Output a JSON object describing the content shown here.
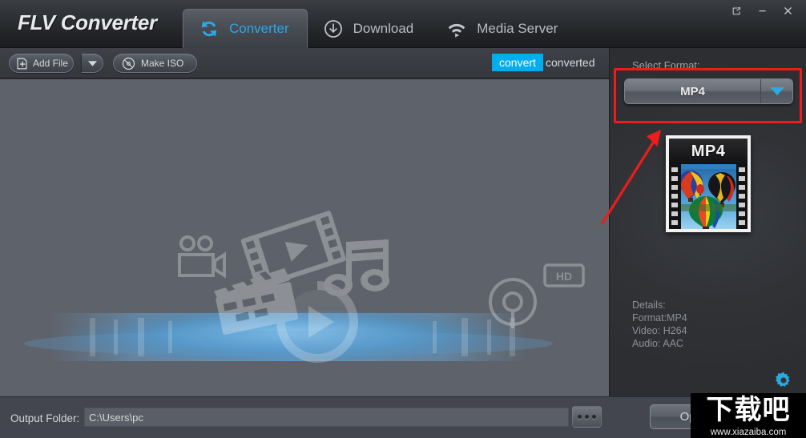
{
  "window": {
    "app_title": "FLV Converter",
    "controls": [
      {
        "name": "restore",
        "icon": "external-link-icon"
      },
      {
        "name": "minimize",
        "icon": "minimize-icon"
      },
      {
        "name": "close",
        "icon": "close-icon"
      }
    ]
  },
  "tabs": [
    {
      "label": "Converter",
      "icon": "refresh-cycle-icon",
      "active": true
    },
    {
      "label": "Download",
      "icon": "download-circle-icon",
      "active": false
    },
    {
      "label": "Media Server",
      "icon": "wifi-play-icon",
      "active": false
    }
  ],
  "toolbar": {
    "add_file_label": "Add File",
    "add_file_icon": "add-file-icon",
    "add_file_dropdown_icon": "chevron-down-icon",
    "make_iso_label": "Make ISO",
    "make_iso_icon": "disc-iso-icon",
    "segment_convert": "convert",
    "segment_converted": "converted",
    "segment_active": "convert",
    "accent_color": "#00aeef"
  },
  "file_list": {
    "placeholder_artwork": "media-icons-illustration",
    "artwork_icons": [
      "film-strip-icon",
      "music-note-icon",
      "video-camera-icon",
      "clapperboard-icon",
      "play-circle-icon",
      "disc-icon",
      "hd-badge-icon"
    ],
    "background_color": "#5e626a",
    "glow_color": "#4a9ad4"
  },
  "right_panel": {
    "select_format_label": "Select Format:",
    "selected_format": "MP4",
    "dropdown_icon": "chevron-down-icon",
    "thumbnail_caption": "MP4",
    "thumbnail_alt": "hot-air-balloons-filmstrip-thumbnail",
    "details_text": "Details:\nFormat:MP4\nVideo: H264\nAudio: AAC",
    "settings_icon": "gear-icon",
    "accent_color": "#2ba9e0",
    "panel_color": "#303236"
  },
  "annotations": {
    "highlight_box_color": "#ee1c1c",
    "arrow_color": "#ee1c1c",
    "highlight_target": "format-combobox"
  },
  "bottom_bar": {
    "output_folder_label": "Output Folder:",
    "output_folder_value": "C:\\Users\\pc",
    "output_folder_placeholder": "C:\\Users\\pc",
    "browse_label": "...",
    "open_label": "Open"
  },
  "watermark": {
    "site_name_cn": "下载吧",
    "site_url": "www.xiazaiba.com"
  }
}
